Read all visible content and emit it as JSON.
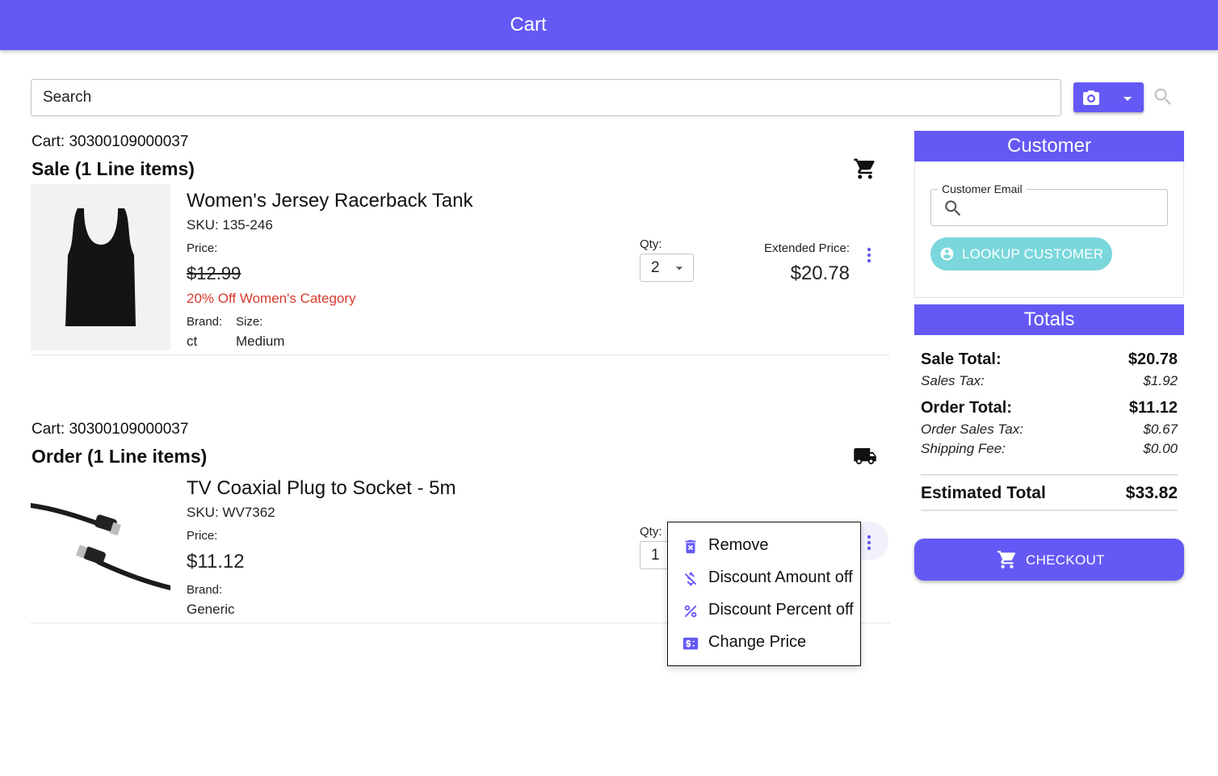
{
  "header": {
    "title": "Cart"
  },
  "search": {
    "placeholder": "Search"
  },
  "icons": {
    "camera": "camera-icon",
    "dropdown": "arrow-drop-down-icon",
    "search": "magnifier-icon",
    "cart": "shopping-cart-icon",
    "truck": "truck-icon",
    "more": "more-vertical-icon",
    "account": "account-circle-icon",
    "remove": "trash-icon",
    "discount_amount": "money-off-icon",
    "discount_percent": "percent-icon",
    "change_price": "price-change-icon"
  },
  "colors": {
    "primary": "#6459f5",
    "discount_text": "#d83a2c",
    "lookup_button": "#7ad7dc"
  },
  "sections": [
    {
      "cart_label": "Cart: 30300109000037",
      "title": "Sale (1 Line items)",
      "item": {
        "name": "Women's Jersey Racerback Tank",
        "sku": "SKU: 135-246",
        "price_label": "Price:",
        "original_price": "$12.99",
        "discount": "20% Off Women's Category",
        "brand_label": "Brand:",
        "brand": "ct",
        "size_label": "Size:",
        "size": "Medium",
        "qty_label": "Qty:",
        "qty": "2",
        "ext_label": "Extended Price:",
        "ext_price": "$20.78"
      }
    },
    {
      "cart_label": "Cart: 30300109000037",
      "title": "Order (1 Line items)",
      "item": {
        "name": "TV Coaxial Plug to Socket - 5m",
        "sku": "SKU: WV7362",
        "price_label": "Price:",
        "price": "$11.12",
        "brand_label": "Brand:",
        "brand": "Generic",
        "qty_label": "Qty:",
        "qty": "1"
      }
    }
  ],
  "context_menu": {
    "items": [
      "Remove",
      "Discount Amount off",
      "Discount Percent off",
      "Change Price"
    ]
  },
  "customer": {
    "title": "Customer",
    "email_label": "Customer Email",
    "email_value": "",
    "lookup_label": "LOOKUP CUSTOMER"
  },
  "totals": {
    "title": "Totals",
    "sale_total_label": "Sale Total:",
    "sale_total": "$20.78",
    "sales_tax_label": "Sales Tax:",
    "sales_tax": "$1.92",
    "order_total_label": "Order Total:",
    "order_total": "$11.12",
    "order_sales_tax_label": "Order Sales Tax:",
    "order_sales_tax": "$0.67",
    "shipping_fee_label": "Shipping Fee:",
    "shipping_fee": "$0.00",
    "estimated_total_label": "Estimated Total",
    "estimated_total": "$33.82"
  },
  "checkout": {
    "label": "CHECKOUT"
  }
}
